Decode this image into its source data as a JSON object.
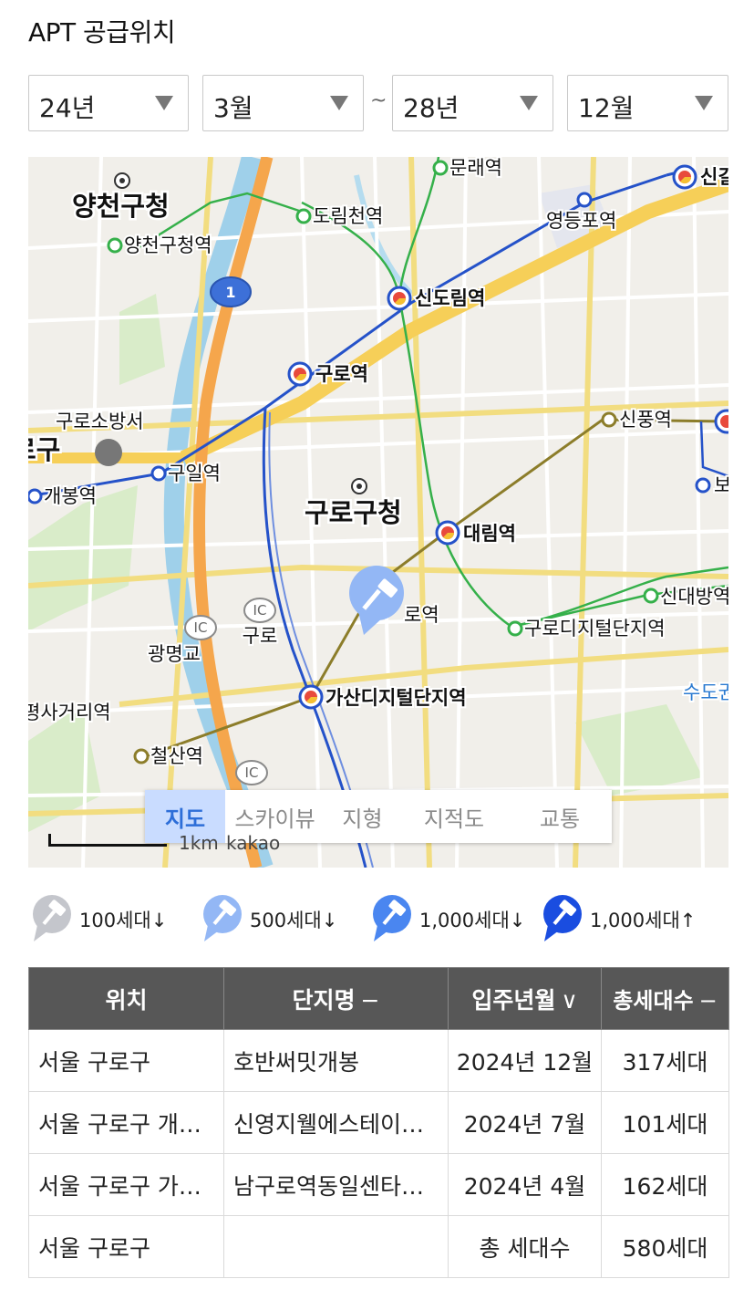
{
  "title": "APT 공급위치",
  "filters": {
    "start_year": "24년",
    "start_month": "3월",
    "separator": "~",
    "end_year": "28년",
    "end_month": "12월"
  },
  "map": {
    "places": {
      "yangcheon_office": "양천구청",
      "guro_office": "구로구청",
      "guro_fire": "구로소방서",
      "guro_partial": "로구",
      "gwangmyeonggyo": "광명교",
      "guro_ic_label": "구로",
      "ic": "IC",
      "sudo_partial": "수도권",
      "sadistreet": "평사거리역"
    },
    "stations": {
      "mullae": "문래역",
      "dorimcheon": "도림천역",
      "yangcheon_office_stn": "양천구청역",
      "yeongdeungpo": "영등포역",
      "sindorim": "신도림역",
      "guro": "구로역",
      "singil_partial": "신길",
      "sinpung": "신풍역",
      "guil": "구일역",
      "gaebong": "개봉역",
      "daerim": "대림역",
      "namguro_partial": "로역",
      "sindaebang": "신대방역",
      "guro_digital": "구로디지털단지역",
      "gasan_digital": "가산디지털단지역",
      "cheolsan": "철산역",
      "bo_partial": "보"
    },
    "route_number": "1",
    "tabs": [
      "지도",
      "스카이뷰",
      "지형",
      "지적도",
      "교통"
    ],
    "active_tab": "지도",
    "scale": "1km",
    "attribution": "kakao"
  },
  "legend": [
    {
      "label": "100세대↓",
      "color": "#c4c6cc"
    },
    {
      "label": "500세대↓",
      "color": "#93b7f5"
    },
    {
      "label": "1,000세대↓",
      "color": "#4a86f0"
    },
    {
      "label": "1,000세대↑",
      "color": "#1a4de0"
    }
  ],
  "table": {
    "headers": {
      "location": "위치",
      "complex": "단지명",
      "complex_sort": "−",
      "move_in": "입주년월",
      "move_in_sort": "∨",
      "households": "총세대수",
      "households_sort": "−"
    },
    "rows": [
      {
        "location": "서울 구로구",
        "complex": "호반써밋개봉",
        "move_in": "2024년 12월",
        "households": "317세대"
      },
      {
        "location": "서울 구로구 개…",
        "complex": "신영지웰에스테이…",
        "move_in": "2024년 7월",
        "households": "101세대"
      },
      {
        "location": "서울 구로구 가…",
        "complex": "남구로역동일센타…",
        "move_in": "2024년 4월",
        "households": "162세대"
      }
    ],
    "total": {
      "location": "서울 구로구",
      "complex": "",
      "label": "총 세대수",
      "households": "580세대"
    }
  }
}
